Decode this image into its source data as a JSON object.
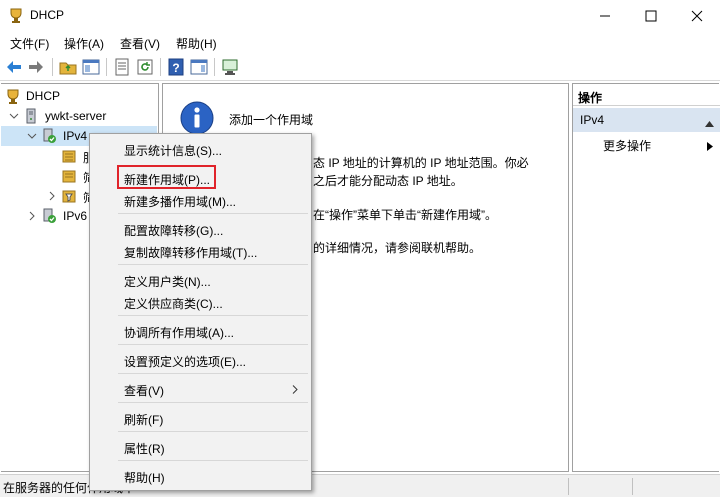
{
  "window": {
    "title": "DHCP",
    "accent": "#1e6fd0"
  },
  "menubar": {
    "items": [
      "文件(F)",
      "操作(A)",
      "查看(V)",
      "帮助(H)"
    ]
  },
  "toolbar": {
    "icons": [
      "back-icon",
      "forward-icon",
      "up-folder-icon",
      "show-hide-tree-icon",
      "properties-icon",
      "refresh-icon",
      "help-icon",
      "show-action-pane-icon",
      "console-icon"
    ]
  },
  "tree": {
    "root": "DHCP",
    "server": "ywkt-server",
    "ipv4": "IPv4",
    "child1": "服",
    "child2": "筛",
    "child3": "筛",
    "ipv6": "IPv6"
  },
  "content": {
    "title": "添加一个作用域",
    "lines": [
      "态 IP 地址的计算机的 IP 地址范围。你必",
      "之后才能分配动态 IP 地址。",
      "在“操作”菜单下单击“新建作用域”。",
      "的详细情况，请参阅联机帮助。"
    ]
  },
  "actions": {
    "header": "操作",
    "section": "IPv4",
    "link": "更多操作"
  },
  "context_menu": {
    "items": [
      "显示统计信息(S)...",
      "新建作用域(P)...",
      "新建多播作用域(M)...",
      "配置故障转移(G)...",
      "复制故障转移作用域(T)...",
      "定义用户类(N)...",
      "定义供应商类(C)...",
      "协调所有作用域(A)...",
      "设置预定义的选项(E)...",
      "查看(V)",
      "刷新(F)",
      "属性(R)",
      "帮助(H)"
    ],
    "highlighted": "新建作用域(P)...",
    "highlight_color": "#e0232a"
  },
  "statusbar": {
    "text": "在服务器的任何作用域中"
  }
}
